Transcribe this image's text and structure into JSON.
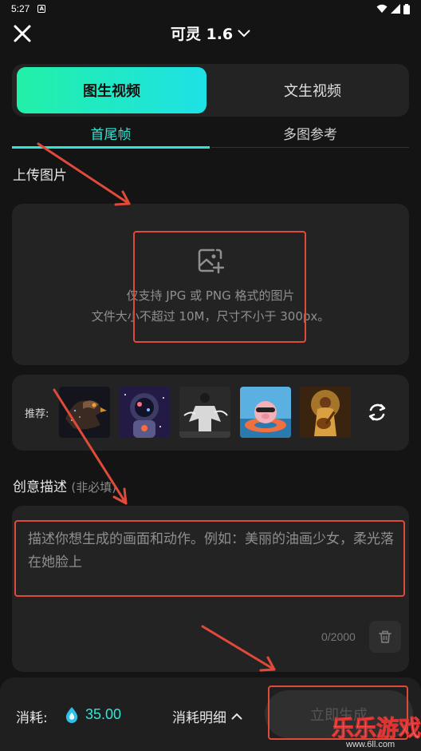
{
  "status_bar": {
    "time": "5:27",
    "notif_icon": "A"
  },
  "header": {
    "title": "可灵 1.6"
  },
  "mode_toggle": {
    "active": "图生视频",
    "inactive": "文生视频"
  },
  "sub_tabs": {
    "active": "首尾帧",
    "inactive": "多图参考"
  },
  "upload": {
    "section_label": "上传图片",
    "line1": "仅支持 JPG 或 PNG 格式的图片",
    "line2": "文件大小不超过 10M，尺寸不小于 300px。"
  },
  "recommend": {
    "label": "推荐:"
  },
  "description": {
    "section_label": "创意描述",
    "section_hint": "(非必填)",
    "placeholder": "描述你想生成的画面和动作。例如：美丽的油画少女，柔光落在她脸上",
    "counter": "0/2000"
  },
  "footer": {
    "cost_label": "消耗:",
    "cost_value": "35.00",
    "detail_label": "消耗明细",
    "generate_label": "立即生成"
  },
  "watermark": {
    "text": "乐乐游戏",
    "url": "www.6ll.com"
  },
  "colors": {
    "accent": "#2ee6d6",
    "highlight": "#e04a3a",
    "toggle_gradient_start": "#22f0a7",
    "toggle_gradient_end": "#1ee1e6"
  }
}
